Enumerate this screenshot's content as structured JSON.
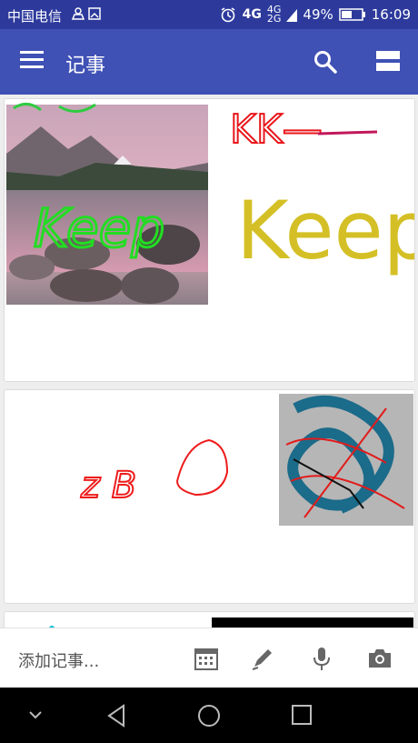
{
  "status": {
    "carrier": "中国电信",
    "network": "4G",
    "battery": "49%",
    "time": "16:09"
  },
  "appbar": {
    "title": "记事"
  },
  "bottom": {
    "add_note_placeholder": "添加记事..."
  },
  "notes": [
    {
      "drawing_text_1": "KK—",
      "drawing_text_2": "Keep",
      "photo_overlay_text": "Keep"
    },
    {
      "drawing_text": "z B"
    }
  ]
}
